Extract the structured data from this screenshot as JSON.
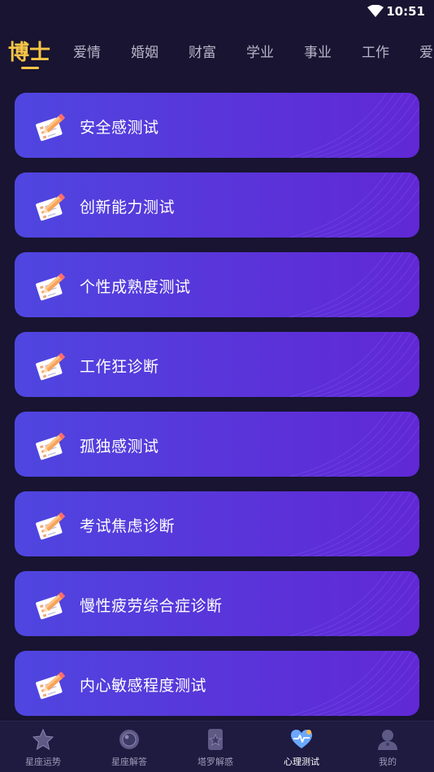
{
  "status_bar": {
    "time": "10:51",
    "icons": [
      "wifi-icon"
    ]
  },
  "tabs": [
    {
      "label": "博士",
      "active": true
    },
    {
      "label": "爱情",
      "active": false
    },
    {
      "label": "婚姻",
      "active": false
    },
    {
      "label": "财富",
      "active": false
    },
    {
      "label": "学业",
      "active": false
    },
    {
      "label": "事业",
      "active": false
    },
    {
      "label": "工作",
      "active": false
    },
    {
      "label": "爱",
      "active": false
    }
  ],
  "tests": [
    {
      "label": "安全感测试",
      "icon": "checklist-pencil-icon"
    },
    {
      "label": "创新能力测试",
      "icon": "checklist-pencil-icon"
    },
    {
      "label": "个性成熟度测试",
      "icon": "checklist-pencil-icon"
    },
    {
      "label": "工作狂诊断",
      "icon": "checklist-pencil-icon"
    },
    {
      "label": "孤独感测试",
      "icon": "checklist-pencil-icon"
    },
    {
      "label": "考试焦虑诊断",
      "icon": "checklist-pencil-icon"
    },
    {
      "label": "慢性疲劳综合症诊断",
      "icon": "checklist-pencil-icon"
    },
    {
      "label": "内心敏感程度测试",
      "icon": "checklist-pencil-icon"
    }
  ],
  "bottom_nav": [
    {
      "label": "星座运势",
      "icon": "star-icon",
      "active": false
    },
    {
      "label": "星座解答",
      "icon": "crystal-ball-icon",
      "active": false
    },
    {
      "label": "塔罗解惑",
      "icon": "tarot-card-icon",
      "active": false
    },
    {
      "label": "心理测试",
      "icon": "heart-pulse-icon",
      "active": true
    },
    {
      "label": "我的",
      "icon": "user-icon",
      "active": false
    }
  ],
  "colors": {
    "background": "#181431",
    "accent": "#f7c646",
    "card_start": "#4f46e0",
    "card_end": "#6128d6",
    "nav_bg": "#1e1a40"
  }
}
